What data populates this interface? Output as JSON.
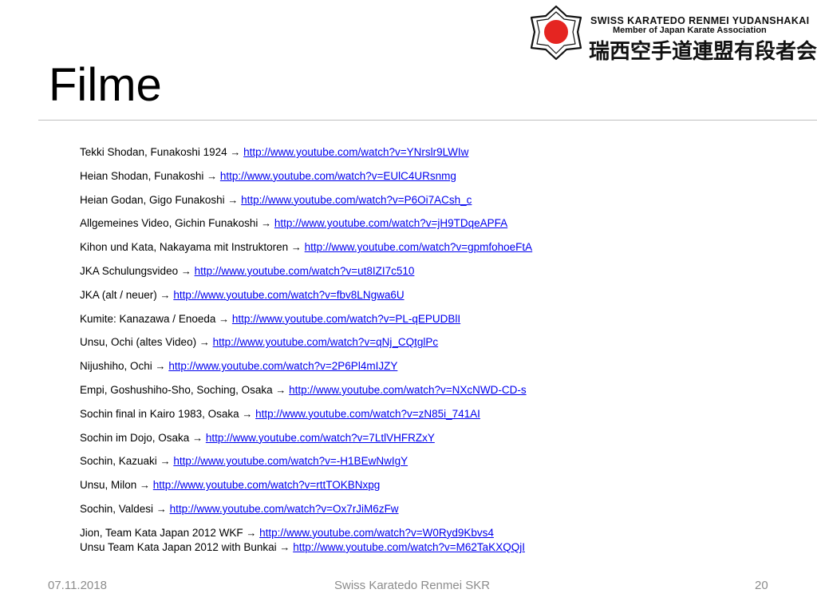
{
  "logo": {
    "line1": "SWISS KARATEDO RENMEI YUDANSHAKAI",
    "line2": "Member of Japan Karate Association",
    "line3": "瑞西空手道連盟有段者会",
    "colors": {
      "sun": "#e52521",
      "outline": "#111111"
    }
  },
  "title": "Filme",
  "bullet": "",
  "arrow": "→",
  "items": [
    {
      "label": "Tekki Shodan, Funakoshi 1924 ",
      "url": "http://www.youtube.com/watch?v=YNrslr9LWIw"
    },
    {
      "label": "Heian Shodan, Funakoshi ",
      "url": "http://www.youtube.com/watch?v=EUlC4URsnmg"
    },
    {
      "label": "Heian Godan, Gigo Funakoshi ",
      "url": "http://www.youtube.com/watch?v=P6Oi7ACsh_c"
    },
    {
      "label": "Allgemeines Video, Gichin Funakoshi ",
      "url": "http://www.youtube.com/watch?v=jH9TDqeAPFA"
    },
    {
      "label": "Kihon und Kata, Nakayama mit Instruktoren ",
      "url": "http://www.youtube.com/watch?v=gpmfohoeFtA"
    },
    {
      "label": "JKA Schulungsvideo ",
      "url": "http://www.youtube.com/watch?v=ut8IZI7c510"
    },
    {
      "label": "JKA (alt / neuer) ",
      "url": "http://www.youtube.com/watch?v=fbv8LNgwa6U"
    },
    {
      "label": "Kumite: Kanazawa / Enoeda ",
      "url": "http://www.youtube.com/watch?v=PL-qEPUDBlI"
    },
    {
      "label": "Unsu, Ochi (altes Video) ",
      "url": "http://www.youtube.com/watch?v=qNj_CQtglPc"
    },
    {
      "label": "Nijushiho, Ochi ",
      "url": "http://www.youtube.com/watch?v=2P6Pl4mIJZY"
    },
    {
      "label": "Empi, Goshushiho-Sho, Soching, Osaka ",
      "url": "http://www.youtube.com/watch?v=NXcNWD-CD-s"
    },
    {
      "label": "Sochin final in Kairo 1983, Osaka ",
      "url": "http://www.youtube.com/watch?v=zN85i_741AI"
    },
    {
      "label": "Sochin im Dojo, Osaka ",
      "url": " http://www.youtube.com/watch?v=7LtlVHFRZxY"
    },
    {
      "label": "Sochin, Kazuaki ",
      "url": "http://www.youtube.com/watch?v=-H1BEwNwIgY"
    },
    {
      "label": "Unsu,  Milon ",
      "url": "http://www.youtube.com/watch?v=rttTOKBNxpg"
    },
    {
      "label": "Sochin, Valdesi ",
      "url": "http://www.youtube.com/watch?v=Ox7rJiM6zFw"
    },
    {
      "label": "Jion, Team Kata Japan 2012 WKF ",
      "url": "http://www.youtube.com/watch?v=W0Ryd9Kbvs4",
      "label2": "Unsu Team Kata Japan 2012 with Bunkai ",
      "url2": "http://www.youtube.com/watch?v=M62TaKXQQjI"
    }
  ],
  "footer": {
    "date": "07.11.2018",
    "center": "Swiss Karatedo Renmei SKR",
    "page": "20"
  }
}
